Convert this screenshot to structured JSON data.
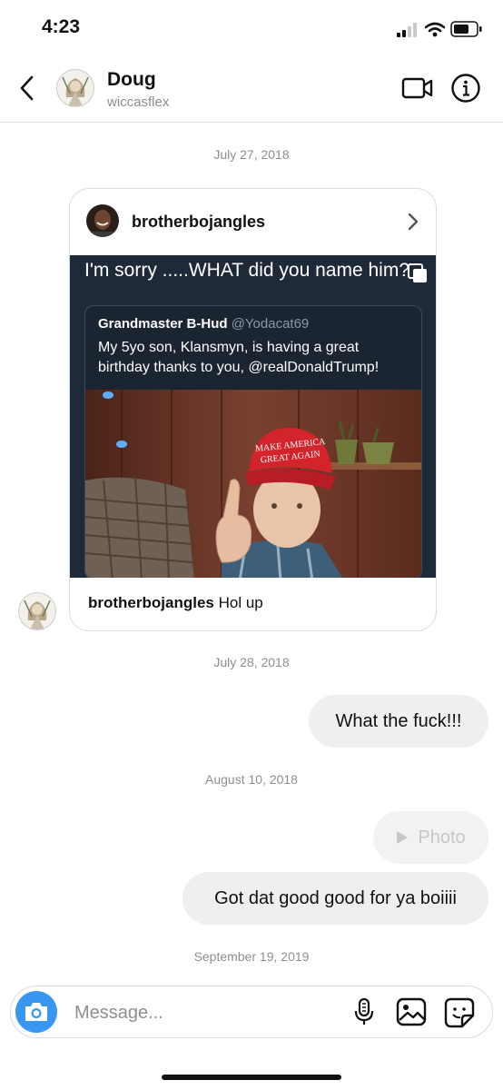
{
  "status_bar": {
    "time": "4:23"
  },
  "header": {
    "name": "Doug",
    "username": "wiccasflex"
  },
  "dates": [
    "July 27, 2018",
    "July 28, 2018",
    "August 10, 2018",
    "September 19, 2019"
  ],
  "shared_post": {
    "author": "brotherbojangles",
    "image_headline": "I'm sorry .....WHAT did you name him?",
    "tweet": {
      "display_name": "Grandmaster B-Hud",
      "handle": "@Yodacat69",
      "text_line1": "My 5yo son, Klansmyn, is having a great",
      "text_line2": "birthday thanks to you, @realDonaldTrump!"
    },
    "hat_text_line1": "MAKE AMERICA",
    "hat_text_line2": "GREAT AGAIN",
    "caption_user": "brotherbojangles",
    "caption_text": "Hol up"
  },
  "messages": {
    "sent_1": "What the fuck!!!",
    "photo_label": "Photo",
    "sent_2": "Got dat good good for ya boiiii"
  },
  "composer": {
    "placeholder": "Message..."
  },
  "colors": {
    "accent_blue": "#3897f0",
    "bubble_gray": "#efefef",
    "muted_text": "#8e8e8e"
  }
}
